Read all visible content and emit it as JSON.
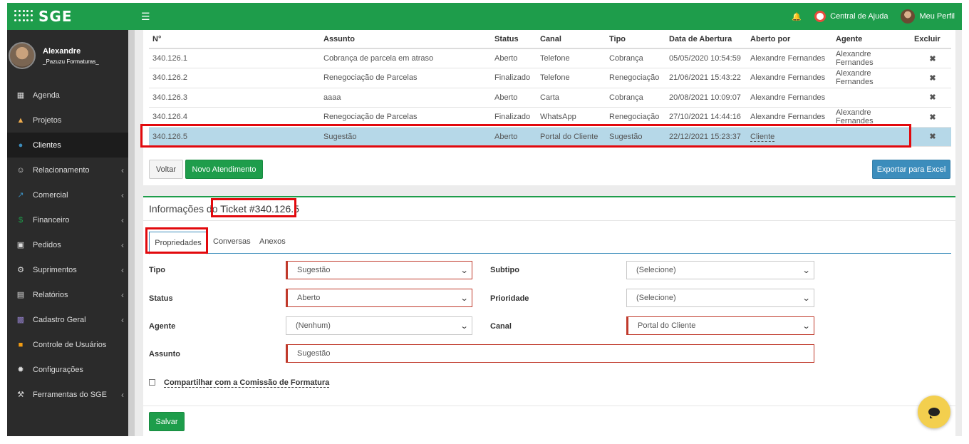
{
  "topbar": {
    "logo_text": "SGE",
    "help_label": "Central de Ajuda",
    "profile_label": "Meu Perfil"
  },
  "user": {
    "name": "Alexandre",
    "org": "_Pazuzu Formaturas_"
  },
  "sidebar": {
    "items": [
      {
        "label": "Agenda",
        "icon": "calendar-icon"
      },
      {
        "label": "Projetos",
        "icon": "folder-icon"
      },
      {
        "label": "Clientes",
        "icon": "user-icon"
      },
      {
        "label": "Relacionamento",
        "icon": "smile-icon"
      },
      {
        "label": "Comercial",
        "icon": "line-chart-icon"
      },
      {
        "label": "Financeiro",
        "icon": "dollar-icon"
      },
      {
        "label": "Pedidos",
        "icon": "cart-icon"
      },
      {
        "label": "Suprimentos",
        "icon": "truck-icon"
      },
      {
        "label": "Relatórios",
        "icon": "report-icon"
      },
      {
        "label": "Cadastro Geral",
        "icon": "grid-icon"
      },
      {
        "label": "Controle de Usuários",
        "icon": "lock-icon"
      },
      {
        "label": "Configurações",
        "icon": "gear-icon"
      },
      {
        "label": "Ferramentas do SGE",
        "icon": "wrench-icon"
      }
    ]
  },
  "table": {
    "headers": [
      "N°",
      "Assunto",
      "Status",
      "Canal",
      "Tipo",
      "Data de Abertura",
      "Aberto por",
      "Agente",
      "Excluir"
    ],
    "rows": [
      {
        "num": "340.126.1",
        "assunto": "Cobrança de parcela em atraso",
        "status": "Aberto",
        "canal": "Telefone",
        "tipo": "Cobrança",
        "data": "05/05/2020 10:54:59",
        "aberto_por": "Alexandre Fernandes",
        "agente": "Alexandre Fernandes"
      },
      {
        "num": "340.126.2",
        "assunto": "Renegociação de Parcelas",
        "status": "Finalizado",
        "canal": "Telefone",
        "tipo": "Renegociação",
        "data": "21/06/2021 15:43:22",
        "aberto_por": "Alexandre Fernandes",
        "agente": "Alexandre Fernandes"
      },
      {
        "num": "340.126.3",
        "assunto": "aaaa",
        "status": "Aberto",
        "canal": "Carta",
        "tipo": "Cobrança",
        "data": "20/08/2021 10:09:07",
        "aberto_por": "Alexandre Fernandes",
        "agente": ""
      },
      {
        "num": "340.126.4",
        "assunto": "Renegociação de Parcelas",
        "status": "Finalizado",
        "canal": "WhatsApp",
        "tipo": "Renegociação",
        "data": "27/10/2021 14:44:16",
        "aberto_por": "Alexandre Fernandes",
        "agente": "Alexandre Fernandes"
      },
      {
        "num": "340.126.5",
        "assunto": "Sugestão",
        "status": "Aberto",
        "canal": "Portal do Cliente",
        "tipo": "Sugestão",
        "data": "22/12/2021 15:23:37",
        "aberto_por": "Cliente",
        "agente": ""
      }
    ],
    "delete_glyph": "✖"
  },
  "buttons": {
    "voltar": "Voltar",
    "novo": "Novo Atendimento",
    "excel": "Exportar para Excel",
    "salvar": "Salvar"
  },
  "info": {
    "title_prefix": "Informações do",
    "ticket": "Ticket #340.126.5"
  },
  "tabs": [
    "Propriedades",
    "Conversas",
    "Anexos"
  ],
  "form": {
    "tipo_label": "Tipo",
    "tipo_value": "Sugestão",
    "subtipo_label": "Subtipo",
    "subtipo_value": "(Selecione)",
    "status_label": "Status",
    "status_value": "Aberto",
    "prioridade_label": "Prioridade",
    "prioridade_value": "(Selecione)",
    "agente_label": "Agente",
    "agente_value": "(Nenhum)",
    "canal_label": "Canal",
    "canal_value": "Portal do Cliente",
    "assunto_label": "Assunto",
    "assunto_value": "Sugestão",
    "compartilhar_label": "Compartilhar com a Comissão de Formatura"
  },
  "colors": {
    "brand_green": "#1e9d4b",
    "sidebar_bg": "#2b2b2b",
    "selected_row": "#b6d8e8",
    "highlight_red": "#e2090d",
    "excel_blue": "#3c8dbc"
  }
}
